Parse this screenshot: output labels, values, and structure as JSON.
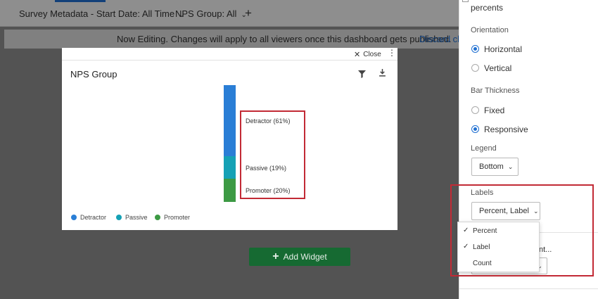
{
  "filterbar": {
    "survey_filter": "Survey Metadata - Start Date: All Time",
    "nps_filter": "NPS Group: All",
    "add_symbol": "+"
  },
  "banner": {
    "message": "Now Editing. Changes will apply to all viewers once this dashboard gets published.",
    "discard": "Discard cha"
  },
  "add_widget": {
    "label": "Add Widget"
  },
  "modal": {
    "close_label": "Close",
    "title": "NPS Group"
  },
  "chart_data": {
    "type": "bar",
    "orientation": "horizontal",
    "stacked": true,
    "title": "NPS Group",
    "series": [
      {
        "name": "Detractor",
        "values": [
          61
        ],
        "color": "#2a7ed6"
      },
      {
        "name": "Passive",
        "values": [
          19
        ],
        "color": "#15a1b5"
      },
      {
        "name": "Promoter",
        "values": [
          20
        ],
        "color": "#3d9a44"
      }
    ],
    "data_labels": [
      "Detractor (61%)",
      "Passive (19%)",
      "Promoter (20%)"
    ],
    "legend": {
      "position": "bottom",
      "entries": [
        "Detractor",
        "Passive",
        "Promoter"
      ]
    }
  },
  "panel": {
    "top_text": "percents",
    "orientation_heading": "Orientation",
    "orientation_options": [
      {
        "label": "Horizontal",
        "selected": true
      },
      {
        "label": "Vertical",
        "selected": false
      }
    ],
    "thickness_heading": "Bar Thickness",
    "thickness_options": [
      {
        "label": "Fixed",
        "selected": false
      },
      {
        "label": "Responsive",
        "selected": true
      }
    ],
    "legend_heading": "Legend",
    "legend_value": "Bottom",
    "labels_heading": "Labels",
    "labels_value": "Percent, Label",
    "partial_text": "nt...",
    "labels_menu": [
      {
        "label": "Percent",
        "checked": true
      },
      {
        "label": "Label",
        "checked": true
      },
      {
        "label": "Count",
        "checked": false
      }
    ]
  },
  "colors": {
    "accent": "#1f6fd1",
    "highlight": "#c22a35",
    "add_widget_bg": "#166a32"
  }
}
